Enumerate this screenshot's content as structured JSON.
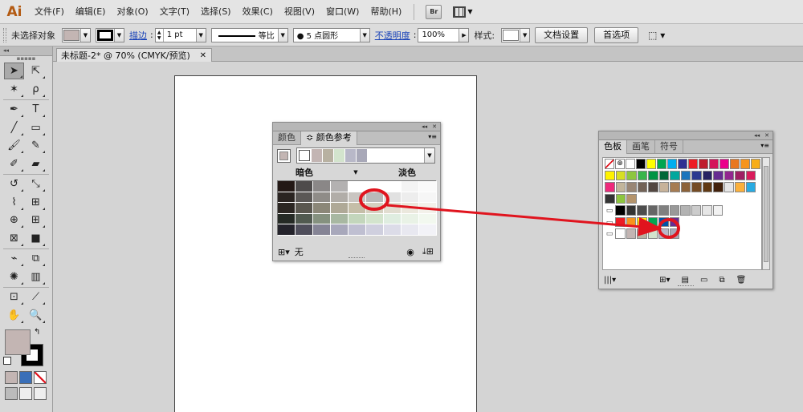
{
  "app": {
    "logo": "Ai",
    "bridge_label": "Br"
  },
  "menu": [
    "文件(F)",
    "编辑(E)",
    "对象(O)",
    "文字(T)",
    "选择(S)",
    "效果(C)",
    "视图(V)",
    "窗口(W)",
    "帮助(H)"
  ],
  "control_bar": {
    "selection_status": "未选择对象",
    "fill_color": "#c3b5b3",
    "stroke_label": "描边",
    "stroke_weight": "1 pt",
    "stroke_profile": "等比",
    "brush": "5 点圆形",
    "opacity_label": "不透明度",
    "opacity_value": "100%",
    "style_label": "样式:",
    "doc_setup_button": "文档设置",
    "preferences_button": "首选项"
  },
  "document": {
    "tab_title": "未标题-2* @ 70% (CMYK/预览)",
    "tab_close": "✕"
  },
  "toolbar": {
    "header": "◂◂",
    "rows": [
      [
        "selection-tool",
        "direct-selection-tool"
      ],
      [
        "magic-wand-tool",
        "lasso-tool"
      ],
      [
        "pen-tool",
        "type-tool"
      ],
      [
        "line-segment-tool",
        "rectangle-tool"
      ],
      [
        "paintbrush-tool",
        "pencil-tool"
      ],
      [
        "blob-brush-tool",
        "eraser-tool"
      ],
      [
        "rotate-tool",
        "scale-tool"
      ],
      [
        "warp-tool",
        "free-transform-tool"
      ],
      [
        "shape-builder-tool",
        "perspective-grid-tool"
      ],
      [
        "mesh-tool",
        "gradient-tool"
      ],
      [
        "eyedropper-tool",
        "blend-tool"
      ],
      [
        "symbol-sprayer-tool",
        "column-graph-tool"
      ],
      [
        "artboard-tool",
        "slice-tool"
      ],
      [
        "hand-tool",
        "zoom-tool"
      ]
    ],
    "glyphs": [
      "➤",
      "⇱",
      "✶",
      "ρ",
      "✒",
      "T",
      "╱",
      "▭",
      "🖌",
      "✎",
      "✐",
      "▰",
      "↺",
      "⤡",
      "⌇",
      "⊞",
      "⊕",
      "⊞",
      "⊠",
      "■",
      "⌁",
      "⧉",
      "✺",
      "▥",
      "⊡",
      "⟋",
      "✋",
      "🔍"
    ],
    "fill_color": "#c3b5b3",
    "stroke_color": "#000000",
    "swap_icon": "↰",
    "mode_colors": [
      "#c3b5b3",
      "#3a6fb8",
      "#ffffff"
    ]
  },
  "color_guide_panel": {
    "tabs": [
      "颜色",
      "颜色参考"
    ],
    "active_tab": 1,
    "base_color": "#c3b5b3",
    "harmony_colors": [
      "#c3b5b3",
      "#b8b1a1",
      "#d3e4cd",
      "#b8b8c8",
      "#a8a8b8"
    ],
    "shade_label": "暗色",
    "tint_label": "淡色",
    "grid": [
      [
        "#231815",
        "#4e4b4b",
        "#8a8787",
        "#b3b1b1",
        "#ffffff",
        "#ffffff",
        "#ffffff",
        "#f4f4f4",
        "#fafafa"
      ],
      [
        "#2a2421",
        "#5b5856",
        "#8f8c88",
        "#b1ada8",
        "#c9c5c1",
        "#b9b9b9",
        "#e1e1e1",
        "#ededed",
        "#f6f6f6"
      ],
      [
        "#2b2622",
        "#5a574f",
        "#8b8778",
        "#afa997",
        "#c5bea8",
        "#d5d0c0",
        "#e1ddd0",
        "#ebe8dd",
        "#f3f1ea"
      ],
      [
        "#252a25",
        "#515a50",
        "#85917f",
        "#a8b8a2",
        "#c3d6bc",
        "#d3e4cd",
        "#dfede0",
        "#e9f2e6",
        "#f2f8ef"
      ],
      [
        "#24232b",
        "#4f4e5b",
        "#858495",
        "#a8a8bb",
        "#bfbfd1",
        "#cfcfde",
        "#dcdce8",
        "#e8e8f0",
        "#f2f2f7"
      ]
    ],
    "footer_text": "无"
  },
  "swatches_panel": {
    "tabs": [
      "色板",
      "画笔",
      "符号"
    ],
    "active_tab": 0,
    "rows": [
      {
        "folder": false,
        "colors": [
          "none",
          "registration",
          "#ffffff",
          "#000000",
          "#ffff00",
          "#00a650",
          "#00aeef",
          "#2e3192",
          "#ed1c24",
          "#be1e2d",
          "#d4145a",
          "#ec008c",
          "#e87722",
          "#f7941d",
          "#f7ad17"
        ]
      },
      {
        "folder": false,
        "colors": [
          "#fff200",
          "#d7df23",
          "#8dc63f",
          "#39b54a",
          "#009444",
          "#006838",
          "#00a79d",
          "#1b75bc",
          "#2b3990",
          "#262262",
          "#662d91",
          "#92278f",
          "#9e1f63",
          "#da1c5c"
        ]
      },
      {
        "folder": false,
        "colors": [
          "#ee2a7b",
          "#c2b59b",
          "#998675",
          "#736357",
          "#534741",
          "#c7b299",
          "#a67c52",
          "#8c6239",
          "#754c24",
          "#603913",
          "#42210b",
          "#e6e6e6",
          "#fbb03b",
          "#29abe2"
        ]
      },
      {
        "folder": false,
        "colors": [
          "#333333",
          "#8dc63f",
          "#b4946c"
        ]
      },
      {
        "folder": true,
        "colors": [
          "#000000",
          "#333333",
          "#4d4d4d",
          "#666666",
          "#808080",
          "#999999",
          "#b3b3b3",
          "#cccccc",
          "#e6e6e6",
          "#f2f2f2"
        ]
      },
      {
        "folder": true,
        "colors": [
          "#ed1c24",
          "#f7941d",
          "#fff200",
          "#00a651",
          "#0054a6",
          "#662d91"
        ]
      },
      {
        "folder": true,
        "colors": [
          "#ffffff",
          "#c3b5b3",
          "#b8b1a1",
          "#d3e4cd",
          "#b8b8c8",
          "#a8a8b8"
        ]
      }
    ]
  },
  "annotation": {
    "color": "#e0141e"
  }
}
